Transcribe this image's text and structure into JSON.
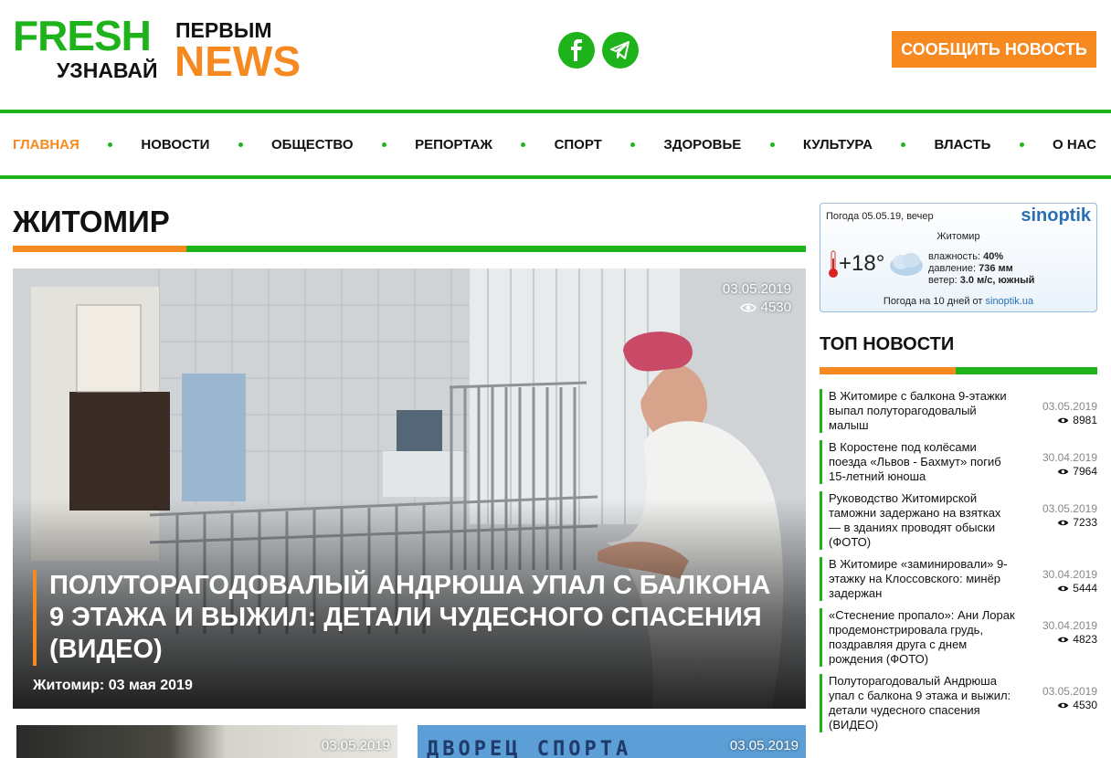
{
  "header": {
    "logo": {
      "fresh": "FRESH",
      "uznavai": "УЗНАВАЙ",
      "pervym": "ПЕРВЫМ",
      "news": "NEWS"
    },
    "social": [
      "facebook-icon",
      "telegram-icon"
    ],
    "report_button": "СООБЩИТЬ НОВОСТЬ"
  },
  "nav": {
    "items": [
      "ГЛАВНАЯ",
      "НОВОСТИ",
      "ОБЩЕСТВО",
      "РЕПОРТАЖ",
      "СПОРТ",
      "ЗДОРОВЬЕ",
      "КУЛЬТУРА",
      "ВЛАСТЬ",
      "О НАС"
    ]
  },
  "section": {
    "title": "ЖИТОМИР"
  },
  "hero": {
    "date": "03.05.2019",
    "views": "4530",
    "title": "ПОЛУТОРАГОДОВАЛЫЙ АНДРЮША УПАЛ С БАЛКОНА 9 ЭТАЖА И ВЫЖИЛ: ДЕТАЛИ ЧУДЕСНОГО СПАСЕНИЯ (ВИДЕО)",
    "place_date": "Житомир: 03 мая 2019"
  },
  "thumbs": [
    {
      "date": "03.05.2019"
    },
    {
      "date": "03.05.2019",
      "banner": "ДВОРЕЦ СПОРТА"
    }
  ],
  "weather": {
    "header": "Погода 05.05.19, вечер",
    "brand": "sinoptik",
    "city": "Житомир",
    "temp": "+18°",
    "humidity_label": "влажность:",
    "humidity": "40%",
    "pressure_label": "давление:",
    "pressure": "736 мм",
    "wind_label": "ветер:",
    "wind": "3.0 м/с, южный",
    "footer_text": "Погода на 10 дней от",
    "footer_link": "sinoptik.ua"
  },
  "top_news": {
    "title": "ТОП НОВОСТИ",
    "items": [
      {
        "title": "В Житомире с балкона 9-этажки выпал полуторагодовалый малыш",
        "date": "03.05.2019",
        "views": "8981"
      },
      {
        "title": "В Коростене под колёсами поезда «Львов - Бахмут» погиб 15-летний юноша",
        "date": "30.04.2019",
        "views": "7964"
      },
      {
        "title": "Руководство Житомирской таможни задержано на взятках — в зданиях проводят обыски (ФОТО)",
        "date": "03.05.2019",
        "views": "7233"
      },
      {
        "title": "В Житомире «заминировали» 9-этажку на Клоссовского: минёр задержан",
        "date": "30.04.2019",
        "views": "5444"
      },
      {
        "title": "«Стеснение пропало»: Ани Лорак продемонстрировала грудь, поздравляя друга с днем рождения (ФОТО)",
        "date": "30.04.2019",
        "views": "4823"
      },
      {
        "title": "Полуторагодовалый Андрюша упал с балкона 9 этажа и выжил: детали чудесного спасения (ВИДЕО)",
        "date": "03.05.2019",
        "views": "4530"
      }
    ]
  },
  "colors": {
    "green": "#1fb31b",
    "orange": "#f6891f"
  }
}
